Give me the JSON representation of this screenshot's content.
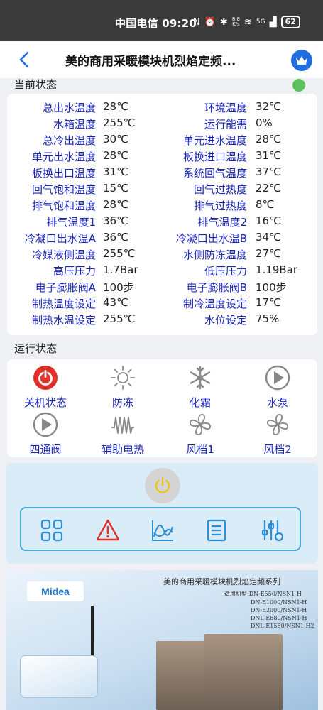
{
  "statusbar": {
    "carrier_time": "中国电信 09:20",
    "net_speed_top": "8.8",
    "net_speed_bottom": "K/s",
    "signal": "5G",
    "battery": "62"
  },
  "header": {
    "title": "美的商用采暖模块机烈焰定频..."
  },
  "current_status": {
    "label": "当前状态",
    "rows": [
      {
        "l1": "总出水温度",
        "v1": "28℃",
        "l2": "环境温度",
        "v2": "32℃"
      },
      {
        "l1": "水箱温度",
        "v1": "255℃",
        "l2": "运行能需",
        "v2": "0%"
      },
      {
        "l1": "总冷出温度",
        "v1": "30℃",
        "l2": "单元进水温度",
        "v2": "28℃"
      },
      {
        "l1": "单元出水温度",
        "v1": "28℃",
        "l2": "板换进口温度",
        "v2": "31℃"
      },
      {
        "l1": "板换出口温度",
        "v1": "31℃",
        "l2": "系统回气温度",
        "v2": "37℃"
      },
      {
        "l1": "回气饱和温度",
        "v1": "15℃",
        "l2": "回气过热度",
        "v2": "22℃"
      },
      {
        "l1": "排气饱和温度",
        "v1": "28℃",
        "l2": "排气过热度",
        "v2": "8℃"
      },
      {
        "l1": "排气温度1",
        "v1": "36℃",
        "l2": "排气温度2",
        "v2": "16℃"
      },
      {
        "l1": "冷凝口出水温A",
        "v1": "36℃",
        "l2": "冷凝口出水温B",
        "v2": "34℃"
      },
      {
        "l1": "冷媒液侧温度",
        "v1": "255℃",
        "l2": "水侧防冻温度",
        "v2": "27℃"
      },
      {
        "l1": "高压压力",
        "v1": "1.7Bar",
        "l2": "低压压力",
        "v2": "1.19Bar"
      },
      {
        "l1": "电子膨胀阀A",
        "v1": "100步",
        "l2": "电子膨胀阀B",
        "v2": "100步"
      },
      {
        "l1": "制热温度设定",
        "v1": "43℃",
        "l2": "制冷温度设定",
        "v2": "17℃"
      },
      {
        "l1": "制热水温设定",
        "v1": "255℃",
        "l2": "水位设定",
        "v2": "75%"
      }
    ]
  },
  "run_status": {
    "label": "运行状态",
    "items": [
      {
        "label": "关机状态",
        "icon": "power-off-icon"
      },
      {
        "label": "防冻",
        "icon": "sun-icon"
      },
      {
        "label": "化霜",
        "icon": "snowflake-icon"
      },
      {
        "label": "水泵",
        "icon": "play-circle-icon"
      },
      {
        "label": "四通阀",
        "icon": "play-circle-icon"
      },
      {
        "label": "辅助电热",
        "icon": "heater-coil-icon"
      },
      {
        "label": "风档1",
        "icon": "fan-icon"
      },
      {
        "label": "风档2",
        "icon": "fan-icon"
      }
    ]
  },
  "banner": {
    "brand": "Midea",
    "title": "美的商用采暖模块机烈焰定频系列",
    "model_heading": "适用机型:DN-E550/NSN1-H",
    "models": [
      "DN-E1000/NSN1-H",
      "DN-E2000/NSN1-H",
      "DNL-E880/NSN1-H",
      "DNL-E1550/NSN1-H2"
    ]
  },
  "colors": {
    "accent": "#1e6ee0",
    "label_blue": "#1a27b8",
    "power_red": "#e0302a",
    "online_green": "#5cc35c",
    "tool_blue": "#2b8fd6"
  }
}
